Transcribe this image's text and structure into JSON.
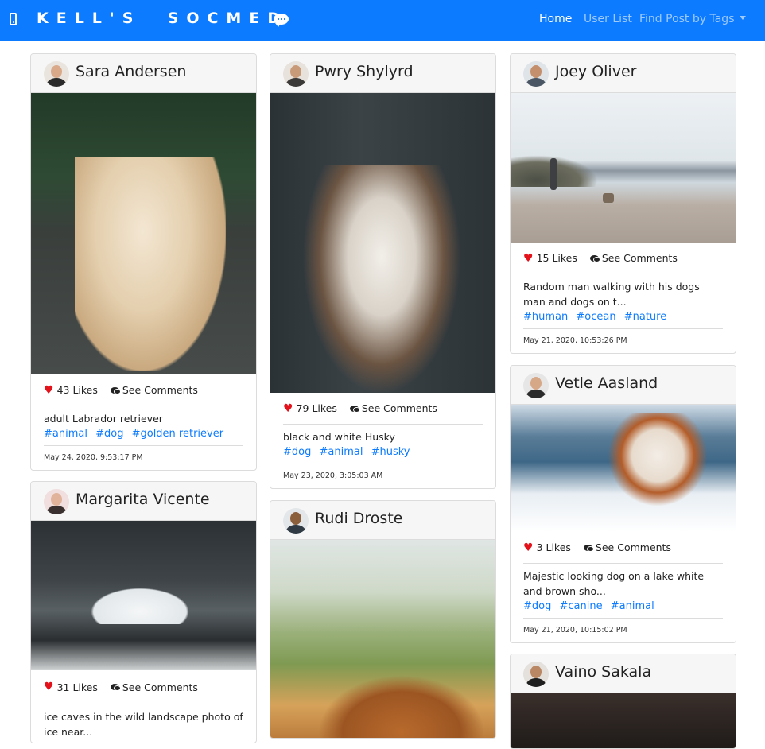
{
  "navbar": {
    "brand": "KELL'S  SOCMED",
    "brand_icon": "mobile-phone-icon",
    "chat_icon": "chat-bubble-icon",
    "links": [
      {
        "label": "Home",
        "active": true
      },
      {
        "label": "User List",
        "active": false
      },
      {
        "label": "Find Post by Tags",
        "active": false,
        "dropdown": true
      }
    ],
    "color": "#0d7bff"
  },
  "posts": [
    {
      "author": "Sara Andersen",
      "likes": "43 Likes",
      "comments_label": "See Comments",
      "caption": "adult Labrador retriever",
      "tags": [
        "#animal",
        "#dog",
        "#golden retriever"
      ],
      "date": "May 24, 2020, 9:53:17 PM"
    },
    {
      "author": "Margarita Vicente",
      "likes": "31 Likes",
      "comments_label": "See Comments",
      "caption": "ice caves in the wild landscape photo of ice near..."
    },
    {
      "author": "Pwry Shylyrd",
      "likes": "79 Likes",
      "comments_label": "See Comments",
      "caption": "black and white Husky",
      "tags": [
        "#dog",
        "#animal",
        "#husky"
      ],
      "date": "May 23, 2020, 3:05:03 AM"
    },
    {
      "author": "Rudi Droste"
    },
    {
      "author": "Joey Oliver",
      "likes": "15 Likes",
      "comments_label": "See Comments",
      "caption": "Random man walking with his dogs man and dogs on t...",
      "tags": [
        "#human",
        "#ocean",
        "#nature"
      ],
      "date": "May 21, 2020, 10:53:26 PM"
    },
    {
      "author": "Vetle Aasland",
      "likes": "3 Likes",
      "comments_label": "See Comments",
      "caption": "Majestic looking dog on a lake white and brown sho...",
      "tags": [
        "#dog",
        "#canine",
        "#animal"
      ],
      "date": "May 21, 2020, 10:15:02 PM"
    },
    {
      "author": "Vaino Sakala"
    }
  ],
  "colors": {
    "like_heart": "#e3121b",
    "tag_link": "#0d7bff"
  }
}
